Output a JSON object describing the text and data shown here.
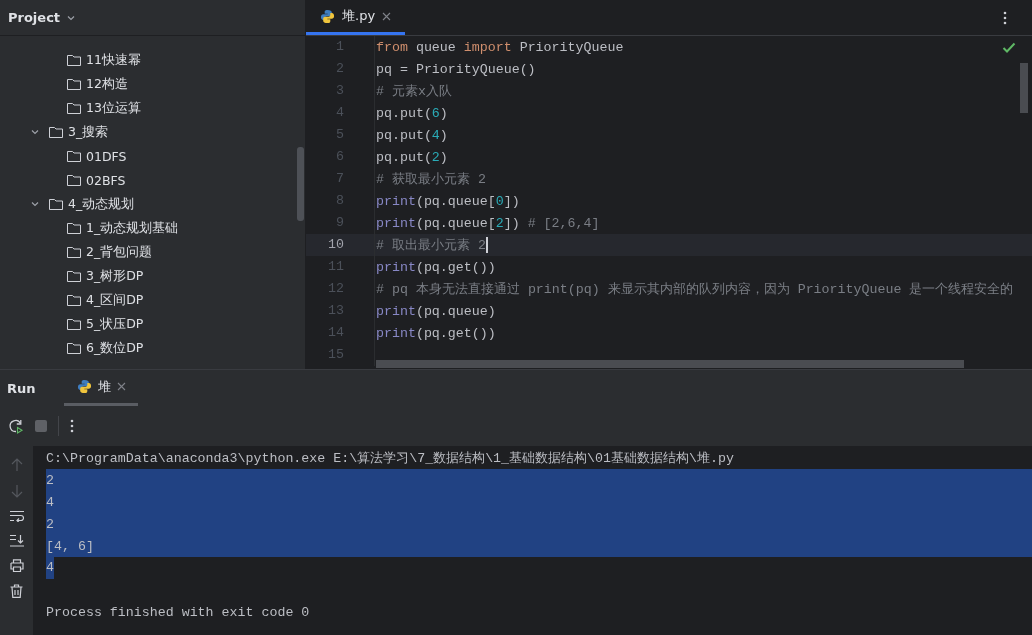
{
  "project_panel": {
    "title": "Project",
    "tree": {
      "trailing_items": [
        {
          "label": "11快速幂"
        },
        {
          "label": "12构造"
        },
        {
          "label": "13位运算"
        }
      ],
      "folders": [
        {
          "label": "3_搜索",
          "expanded": true,
          "children": [
            {
              "label": "01DFS"
            },
            {
              "label": "02BFS"
            }
          ]
        },
        {
          "label": "4_动态规划",
          "expanded": true,
          "children": [
            {
              "label": "1_动态规划基础"
            },
            {
              "label": "2_背包问题"
            },
            {
              "label": "3_树形DP"
            },
            {
              "label": "4_区间DP"
            },
            {
              "label": "5_状压DP"
            },
            {
              "label": "6_数位DP"
            }
          ]
        }
      ]
    }
  },
  "editor": {
    "tabs": [
      {
        "label": "堆.py",
        "selected": true
      }
    ],
    "lines": [
      {
        "number": "1",
        "current": false,
        "tokens": [
          {
            "text": "from",
            "kind": "keyword"
          },
          {
            "text": " queue ",
            "kind": "plain"
          },
          {
            "text": "import",
            "kind": "keyword"
          },
          {
            "text": " PriorityQueue",
            "kind": "plain"
          }
        ]
      },
      {
        "number": "2",
        "current": false,
        "tokens": [
          {
            "text": "pq = PriorityQueue()",
            "kind": "plain"
          }
        ]
      },
      {
        "number": "3",
        "current": false,
        "tokens": [
          {
            "text": "# 元素x入队",
            "kind": "comment"
          }
        ]
      },
      {
        "number": "4",
        "current": false,
        "tokens": [
          {
            "text": "pq.put(",
            "kind": "plain"
          },
          {
            "text": "6",
            "kind": "number"
          },
          {
            "text": ")",
            "kind": "plain"
          }
        ]
      },
      {
        "number": "5",
        "current": false,
        "tokens": [
          {
            "text": "pq.put(",
            "kind": "plain"
          },
          {
            "text": "4",
            "kind": "number"
          },
          {
            "text": ")",
            "kind": "plain"
          }
        ]
      },
      {
        "number": "6",
        "current": false,
        "tokens": [
          {
            "text": "pq.put(",
            "kind": "plain"
          },
          {
            "text": "2",
            "kind": "number"
          },
          {
            "text": ")",
            "kind": "plain"
          }
        ]
      },
      {
        "number": "7",
        "current": false,
        "tokens": [
          {
            "text": "# 获取最小元素 2",
            "kind": "comment"
          }
        ]
      },
      {
        "number": "8",
        "current": false,
        "tokens": [
          {
            "text": "print",
            "kind": "builtin"
          },
          {
            "text": "(pq.queue[",
            "kind": "plain"
          },
          {
            "text": "0",
            "kind": "number"
          },
          {
            "text": "])",
            "kind": "plain"
          }
        ]
      },
      {
        "number": "9",
        "current": false,
        "tokens": [
          {
            "text": "print",
            "kind": "builtin"
          },
          {
            "text": "(pq.queue[",
            "kind": "plain"
          },
          {
            "text": "2",
            "kind": "number"
          },
          {
            "text": "]) ",
            "kind": "plain"
          },
          {
            "text": "# [2,6,4]",
            "kind": "comment"
          }
        ]
      },
      {
        "number": "10",
        "current": true,
        "tokens": [
          {
            "text": "# 取出最小元素 2",
            "kind": "comment"
          }
        ]
      },
      {
        "number": "11",
        "current": false,
        "tokens": [
          {
            "text": "print",
            "kind": "builtin"
          },
          {
            "text": "(pq.get())",
            "kind": "plain"
          }
        ]
      },
      {
        "number": "12",
        "current": false,
        "tokens": [
          {
            "text": "# pq 本身无法直接通过 print(pq) 来显示其内部的队列内容，因为 PriorityQueue 是一个线程安全的",
            "kind": "comment"
          }
        ]
      },
      {
        "number": "13",
        "current": false,
        "tokens": [
          {
            "text": "print",
            "kind": "builtin"
          },
          {
            "text": "(pq.queue)",
            "kind": "plain"
          }
        ]
      },
      {
        "number": "14",
        "current": false,
        "tokens": [
          {
            "text": "print",
            "kind": "builtin"
          },
          {
            "text": "(pq.get())",
            "kind": "plain"
          }
        ]
      },
      {
        "number": "15",
        "current": false
      }
    ]
  },
  "run_panel": {
    "title": "Run",
    "tabs": [
      {
        "label": "堆",
        "selected": true
      }
    ],
    "console": [
      {
        "text": "C:\\ProgramData\\anaconda3\\python.exe E:\\算法学习\\7_数据结构\\1_基础数据结构\\01基础数据结构\\堆.py",
        "selected": false
      },
      {
        "text": "2",
        "selected": true
      },
      {
        "text": "4",
        "selected": true
      },
      {
        "text": "2",
        "selected": true
      },
      {
        "text": "[4, 6]",
        "selected": true
      },
      {
        "text": "4",
        "selected": true
      },
      {
        "selected": false
      },
      {
        "text": "Process finished with exit code 0",
        "selected": false
      }
    ]
  }
}
